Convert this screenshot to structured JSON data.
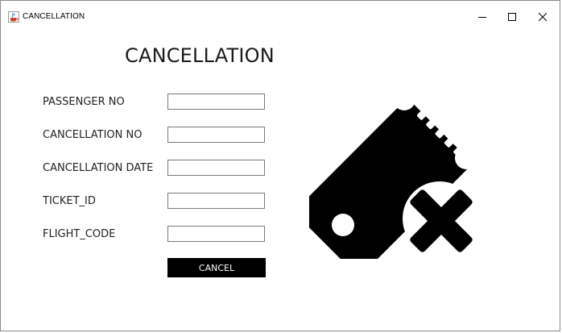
{
  "window": {
    "title": "CANCELLATION",
    "icon": "java-cup-icon",
    "controls": [
      "minimize-icon",
      "maximize-icon",
      "close-icon"
    ]
  },
  "form": {
    "heading": "CANCELLATION",
    "fields": [
      {
        "label": "PASSENGER NO",
        "value": ""
      },
      {
        "label": "CANCELLATION NO",
        "value": ""
      },
      {
        "label": "CANCELLATION DATE",
        "value": ""
      },
      {
        "label": "TICKET_ID",
        "value": ""
      },
      {
        "label": "FLIGHT_CODE",
        "value": ""
      }
    ],
    "submit_label": "CANCEL"
  },
  "illustration": {
    "icon": "ticket-cancel-icon",
    "color": "#000000"
  }
}
